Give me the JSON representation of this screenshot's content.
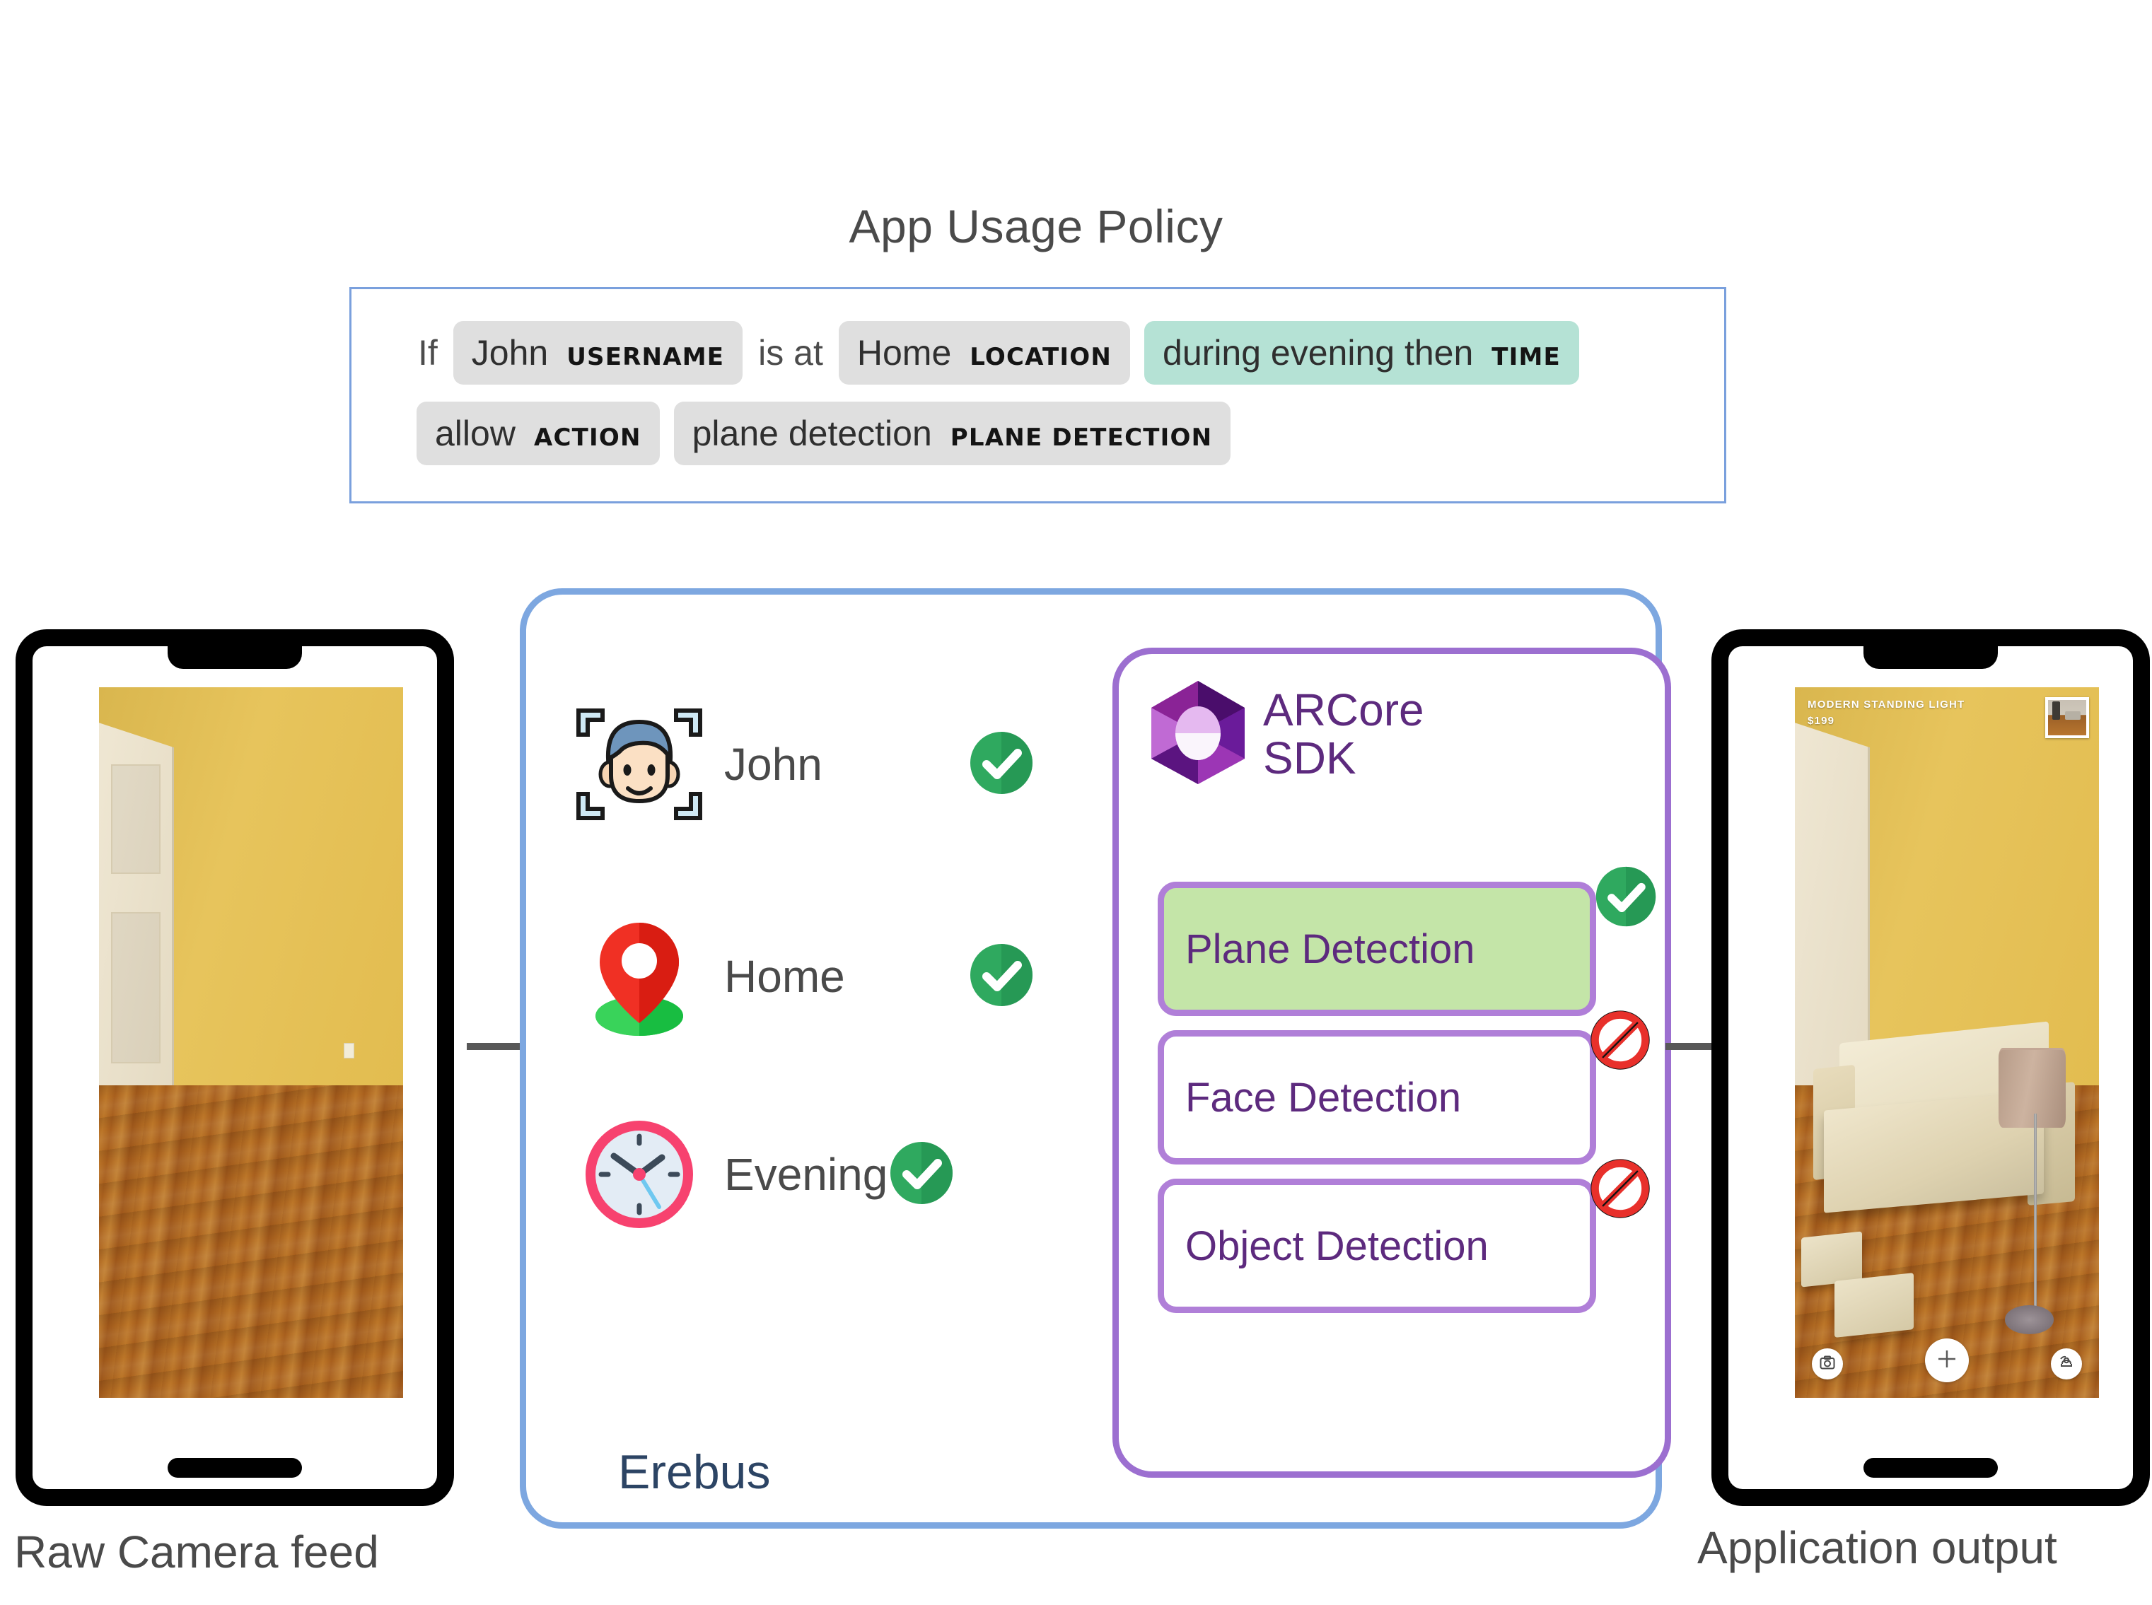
{
  "policy": {
    "title": "App Usage Policy",
    "row1": [
      {
        "kind": "plain",
        "text": "If"
      },
      {
        "kind": "token",
        "style": "grey",
        "value": "John",
        "tag": "USERNAME"
      },
      {
        "kind": "plain",
        "text": "is at"
      },
      {
        "kind": "token",
        "style": "grey",
        "value": "Home",
        "tag": "LOCATION"
      },
      {
        "kind": "token",
        "style": "teal",
        "value": "during evening then",
        "tag": "TIME"
      }
    ],
    "row2": [
      {
        "kind": "token",
        "style": "grey",
        "value": "allow",
        "tag": "ACTION"
      },
      {
        "kind": "token",
        "style": "grey",
        "value": "plane detection",
        "tag": "PLANE DETECTION"
      }
    ],
    "border_color": "#7aa0dd",
    "token_grey": "#dfdfdf",
    "token_teal": "#b5e2d5"
  },
  "left_phone": {
    "caption": "Raw Camera feed"
  },
  "right_phone": {
    "caption": "Application output",
    "ar_label_line1": "MODERN STANDING LIGHT",
    "ar_label_line2": "$199",
    "controls": [
      {
        "name": "screenshot",
        "icon": "camera-icon"
      },
      {
        "name": "place-object",
        "icon": "plus-icon"
      },
      {
        "name": "switch-model",
        "icon": "swap-furniture-icon"
      }
    ]
  },
  "erebus": {
    "label": "Erebus",
    "border_color": "#7da7e0",
    "conditions": [
      {
        "icon": "face-scan-icon",
        "label": "John",
        "status": "allowed",
        "status_icon": "green-check-icon"
      },
      {
        "icon": "map-pin-icon",
        "label": "Home",
        "status": "allowed",
        "status_icon": "green-check-icon"
      },
      {
        "icon": "clock-icon",
        "label": "Evening",
        "status": "allowed",
        "status_icon": "green-check-icon"
      }
    ]
  },
  "arcore": {
    "title_line1": "ARCore",
    "title_line2": "SDK",
    "border_color": "#9c6fd0",
    "logo_icon": "arcore-hexagon-logo",
    "features": [
      {
        "label": "Plane Detection",
        "state": "enabled",
        "badge_icon": "green-check-icon",
        "fill": "#c4e5a8"
      },
      {
        "label": "Face Detection",
        "state": "blocked",
        "badge_icon": "no-entry-icon",
        "fill": "#ffffff"
      },
      {
        "label": "Object Detection",
        "state": "blocked",
        "badge_icon": "no-entry-icon",
        "fill": "#ffffff"
      }
    ]
  },
  "arrows": {
    "color": "#585858",
    "left_to_erebus": "arrow-right-icon",
    "erebus_to_output": "arrow-right-icon"
  }
}
